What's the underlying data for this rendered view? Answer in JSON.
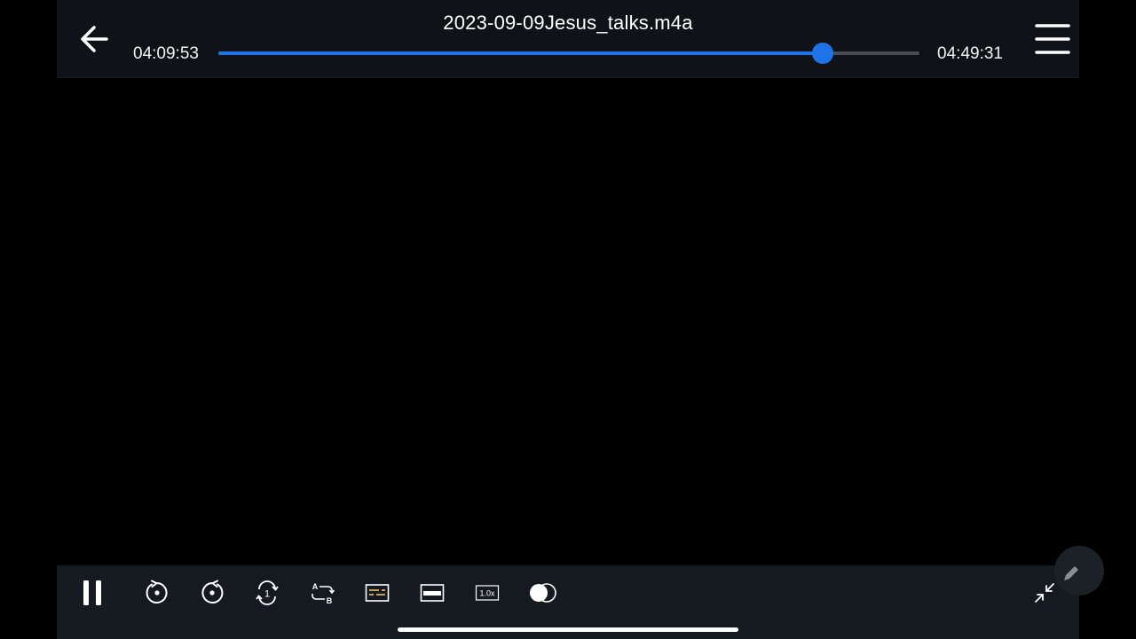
{
  "header": {
    "title": "2023-09-09Jesus_talks.m4a",
    "elapsed": "04:09:53",
    "duration": "04:49:31",
    "progress_fraction": 0.862
  },
  "icons": {
    "back": "arrow-left-icon",
    "menu": "hamburger-menu-icon",
    "pause": "pause-icon",
    "rewind": "rewind-icon",
    "forward": "fast-forward-icon",
    "repeat_one": "repeat-one-icon",
    "ab_repeat": "ab-repeat-icon",
    "subtitles": "subtitles-icon",
    "subtitle_bar": "subtitle-bar-icon",
    "playback_speed": "playback-speed-icon",
    "mode_toggle": "mode-toggle-icon",
    "collapse": "collapse-icon",
    "edit": "pencil-icon"
  },
  "controls": {
    "speed_label": "1.0x",
    "ab_label_a": "A",
    "ab_label_b": "B",
    "repeat_label": "1"
  },
  "colors": {
    "accent": "#1e73e8",
    "topbar_bg": "#0f1318",
    "bottombar_bg": "#151a21",
    "subtitle_icon_accent": "#e0b25a"
  }
}
